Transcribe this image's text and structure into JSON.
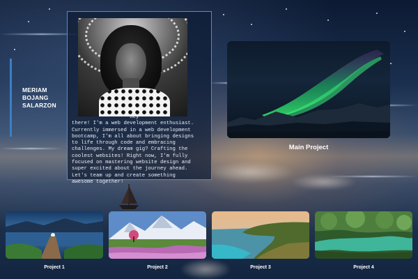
{
  "profile": {
    "name_lines": [
      "MERIAM",
      "BOJANG",
      "SALARZON"
    ],
    "bio": "                   Hey\nthere! I'm a web development enthusiast.\nCurrently immersed in a web development\nbootcamp, I'm all about bringing designs\nto life through code and embracing\nchallenges. My dream gig? Crafting the\ncoolest websites! Right now, I'm fully\nfocused on mastering website design and\nsuper excited about the journey ahead.\nLet's team up and create something\nawesome together!",
    "accent_color": "#3d7fc4"
  },
  "main_project": {
    "label": "Main Project"
  },
  "projects": [
    {
      "label": "Project 1",
      "scene": "lake-pier-icon"
    },
    {
      "label": "Project 2",
      "scene": "mountain-meadow-icon"
    },
    {
      "label": "Project 3",
      "scene": "coast-cliff-icon"
    },
    {
      "label": "Project 4",
      "scene": "forest-river-icon"
    }
  ]
}
